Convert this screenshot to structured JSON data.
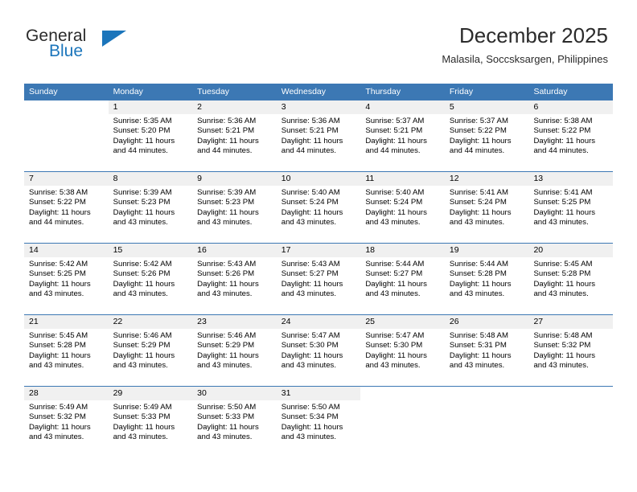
{
  "brand": {
    "name_part1": "General",
    "name_part2": "Blue",
    "flag_icon": "triangle-flag-icon",
    "accent_color": "#1b75bb"
  },
  "header": {
    "title": "December 2025",
    "subtitle": "Malasila, Soccsksargen, Philippines"
  },
  "calendar": {
    "header_bg": "#3c78b4",
    "daynum_bg": "#f0f0f0",
    "weekdays": [
      "Sunday",
      "Monday",
      "Tuesday",
      "Wednesday",
      "Thursday",
      "Friday",
      "Saturday"
    ],
    "weeks": [
      [
        {
          "day": "",
          "sunrise": "",
          "sunset": "",
          "daylight": ""
        },
        {
          "day": "1",
          "sunrise": "Sunrise: 5:35 AM",
          "sunset": "Sunset: 5:20 PM",
          "daylight": "Daylight: 11 hours and 44 minutes."
        },
        {
          "day": "2",
          "sunrise": "Sunrise: 5:36 AM",
          "sunset": "Sunset: 5:21 PM",
          "daylight": "Daylight: 11 hours and 44 minutes."
        },
        {
          "day": "3",
          "sunrise": "Sunrise: 5:36 AM",
          "sunset": "Sunset: 5:21 PM",
          "daylight": "Daylight: 11 hours and 44 minutes."
        },
        {
          "day": "4",
          "sunrise": "Sunrise: 5:37 AM",
          "sunset": "Sunset: 5:21 PM",
          "daylight": "Daylight: 11 hours and 44 minutes."
        },
        {
          "day": "5",
          "sunrise": "Sunrise: 5:37 AM",
          "sunset": "Sunset: 5:22 PM",
          "daylight": "Daylight: 11 hours and 44 minutes."
        },
        {
          "day": "6",
          "sunrise": "Sunrise: 5:38 AM",
          "sunset": "Sunset: 5:22 PM",
          "daylight": "Daylight: 11 hours and 44 minutes."
        }
      ],
      [
        {
          "day": "7",
          "sunrise": "Sunrise: 5:38 AM",
          "sunset": "Sunset: 5:22 PM",
          "daylight": "Daylight: 11 hours and 44 minutes."
        },
        {
          "day": "8",
          "sunrise": "Sunrise: 5:39 AM",
          "sunset": "Sunset: 5:23 PM",
          "daylight": "Daylight: 11 hours and 43 minutes."
        },
        {
          "day": "9",
          "sunrise": "Sunrise: 5:39 AM",
          "sunset": "Sunset: 5:23 PM",
          "daylight": "Daylight: 11 hours and 43 minutes."
        },
        {
          "day": "10",
          "sunrise": "Sunrise: 5:40 AM",
          "sunset": "Sunset: 5:24 PM",
          "daylight": "Daylight: 11 hours and 43 minutes."
        },
        {
          "day": "11",
          "sunrise": "Sunrise: 5:40 AM",
          "sunset": "Sunset: 5:24 PM",
          "daylight": "Daylight: 11 hours and 43 minutes."
        },
        {
          "day": "12",
          "sunrise": "Sunrise: 5:41 AM",
          "sunset": "Sunset: 5:24 PM",
          "daylight": "Daylight: 11 hours and 43 minutes."
        },
        {
          "day": "13",
          "sunrise": "Sunrise: 5:41 AM",
          "sunset": "Sunset: 5:25 PM",
          "daylight": "Daylight: 11 hours and 43 minutes."
        }
      ],
      [
        {
          "day": "14",
          "sunrise": "Sunrise: 5:42 AM",
          "sunset": "Sunset: 5:25 PM",
          "daylight": "Daylight: 11 hours and 43 minutes."
        },
        {
          "day": "15",
          "sunrise": "Sunrise: 5:42 AM",
          "sunset": "Sunset: 5:26 PM",
          "daylight": "Daylight: 11 hours and 43 minutes."
        },
        {
          "day": "16",
          "sunrise": "Sunrise: 5:43 AM",
          "sunset": "Sunset: 5:26 PM",
          "daylight": "Daylight: 11 hours and 43 minutes."
        },
        {
          "day": "17",
          "sunrise": "Sunrise: 5:43 AM",
          "sunset": "Sunset: 5:27 PM",
          "daylight": "Daylight: 11 hours and 43 minutes."
        },
        {
          "day": "18",
          "sunrise": "Sunrise: 5:44 AM",
          "sunset": "Sunset: 5:27 PM",
          "daylight": "Daylight: 11 hours and 43 minutes."
        },
        {
          "day": "19",
          "sunrise": "Sunrise: 5:44 AM",
          "sunset": "Sunset: 5:28 PM",
          "daylight": "Daylight: 11 hours and 43 minutes."
        },
        {
          "day": "20",
          "sunrise": "Sunrise: 5:45 AM",
          "sunset": "Sunset: 5:28 PM",
          "daylight": "Daylight: 11 hours and 43 minutes."
        }
      ],
      [
        {
          "day": "21",
          "sunrise": "Sunrise: 5:45 AM",
          "sunset": "Sunset: 5:28 PM",
          "daylight": "Daylight: 11 hours and 43 minutes."
        },
        {
          "day": "22",
          "sunrise": "Sunrise: 5:46 AM",
          "sunset": "Sunset: 5:29 PM",
          "daylight": "Daylight: 11 hours and 43 minutes."
        },
        {
          "day": "23",
          "sunrise": "Sunrise: 5:46 AM",
          "sunset": "Sunset: 5:29 PM",
          "daylight": "Daylight: 11 hours and 43 minutes."
        },
        {
          "day": "24",
          "sunrise": "Sunrise: 5:47 AM",
          "sunset": "Sunset: 5:30 PM",
          "daylight": "Daylight: 11 hours and 43 minutes."
        },
        {
          "day": "25",
          "sunrise": "Sunrise: 5:47 AM",
          "sunset": "Sunset: 5:30 PM",
          "daylight": "Daylight: 11 hours and 43 minutes."
        },
        {
          "day": "26",
          "sunrise": "Sunrise: 5:48 AM",
          "sunset": "Sunset: 5:31 PM",
          "daylight": "Daylight: 11 hours and 43 minutes."
        },
        {
          "day": "27",
          "sunrise": "Sunrise: 5:48 AM",
          "sunset": "Sunset: 5:32 PM",
          "daylight": "Daylight: 11 hours and 43 minutes."
        }
      ],
      [
        {
          "day": "28",
          "sunrise": "Sunrise: 5:49 AM",
          "sunset": "Sunset: 5:32 PM",
          "daylight": "Daylight: 11 hours and 43 minutes."
        },
        {
          "day": "29",
          "sunrise": "Sunrise: 5:49 AM",
          "sunset": "Sunset: 5:33 PM",
          "daylight": "Daylight: 11 hours and 43 minutes."
        },
        {
          "day": "30",
          "sunrise": "Sunrise: 5:50 AM",
          "sunset": "Sunset: 5:33 PM",
          "daylight": "Daylight: 11 hours and 43 minutes."
        },
        {
          "day": "31",
          "sunrise": "Sunrise: 5:50 AM",
          "sunset": "Sunset: 5:34 PM",
          "daylight": "Daylight: 11 hours and 43 minutes."
        },
        {
          "day": "",
          "sunrise": "",
          "sunset": "",
          "daylight": ""
        },
        {
          "day": "",
          "sunrise": "",
          "sunset": "",
          "daylight": ""
        },
        {
          "day": "",
          "sunrise": "",
          "sunset": "",
          "daylight": ""
        }
      ]
    ]
  }
}
